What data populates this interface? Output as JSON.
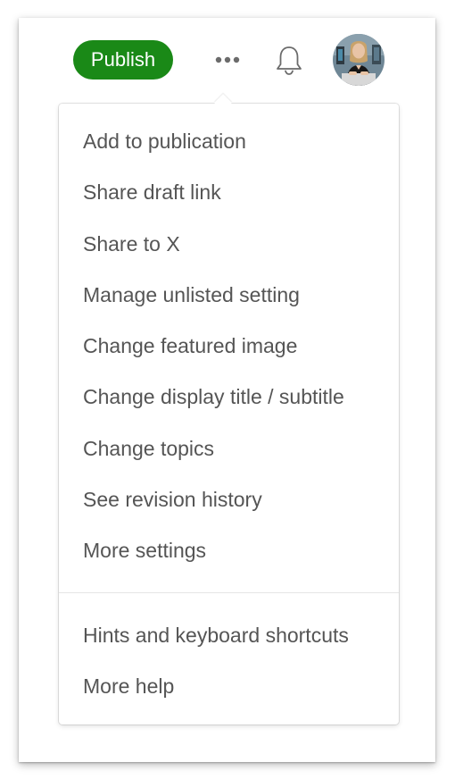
{
  "header": {
    "publish_label": "Publish",
    "more_icon": "more-horizontal-icon",
    "notifications_icon": "bell-icon",
    "avatar_icon": "user-avatar"
  },
  "colors": {
    "publish_bg": "#1a8917",
    "menu_text": "#555555",
    "divider": "#e6e6e6"
  },
  "menu": {
    "primary_items": [
      {
        "label": "Add to publication"
      },
      {
        "label": "Share draft link"
      },
      {
        "label": "Share to X"
      },
      {
        "label": "Manage unlisted setting"
      },
      {
        "label": "Change featured image"
      },
      {
        "label": "Change display title / subtitle"
      },
      {
        "label": "Change topics"
      },
      {
        "label": "See revision history"
      },
      {
        "label": "More settings"
      }
    ],
    "secondary_items": [
      {
        "label": "Hints and keyboard shortcuts"
      },
      {
        "label": "More help"
      }
    ]
  }
}
